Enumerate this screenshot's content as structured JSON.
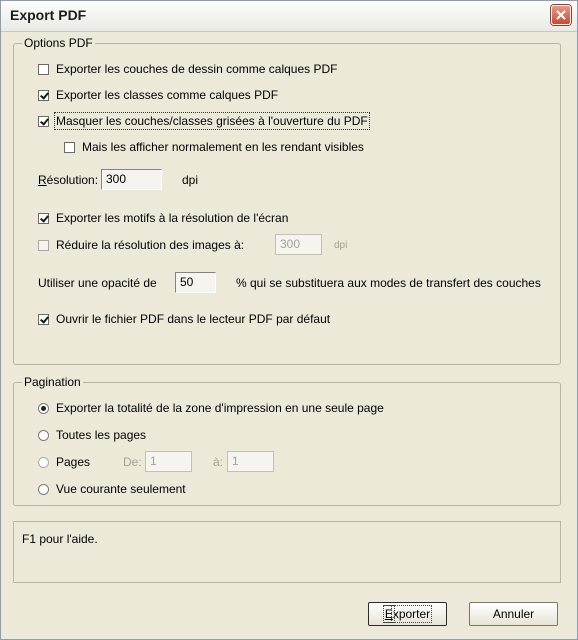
{
  "window": {
    "title": "Export PDF"
  },
  "options": {
    "group_title": "Options PDF",
    "export_layers": {
      "label": "Exporter les couches de dessin comme calques PDF",
      "checked": false
    },
    "export_classes": {
      "label": "Exporter les classes comme calques PDF",
      "checked": true
    },
    "hide_greyed": {
      "label": "Masquer les couches/classes grisées à l'ouverture du PDF",
      "checked": true
    },
    "show_normally": {
      "label": "Mais les afficher normalement en les rendant visibles",
      "checked": false
    },
    "resolution": {
      "label_mnemonic": "R",
      "label_rest": "ésolution:",
      "value": "300",
      "unit": "dpi"
    },
    "export_patterns": {
      "label": "Exporter les motifs à la résolution de l'écran",
      "checked": true
    },
    "reduce_images": {
      "label": "Réduire la résolution des images à:",
      "checked": false,
      "value": "300",
      "unit": "dpi"
    },
    "opacity": {
      "label_before": "Utiliser une opacité de",
      "value": "50",
      "label_after": "% qui se substituera aux modes de transfert des couches"
    },
    "open_pdf": {
      "label": "Ouvrir le fichier PDF dans le lecteur PDF par défaut",
      "checked": true
    }
  },
  "pagination": {
    "group_title": "Pagination",
    "all_area": {
      "label": "Exporter la totalité de la zone d'impression en une seule page",
      "selected": true
    },
    "all_pages": {
      "label": "Toutes les pages",
      "selected": false
    },
    "pages": {
      "label": "Pages",
      "from_label": "De:",
      "from_value": "1",
      "to_label": "à:",
      "to_value": "1",
      "selected": false
    },
    "current_view": {
      "label": "Vue courante seulement",
      "selected": false
    }
  },
  "help": {
    "text": "F1 pour l'aide."
  },
  "buttons": {
    "export_mnemonic": "E",
    "export_rest": "xporter",
    "cancel": "Annuler"
  }
}
